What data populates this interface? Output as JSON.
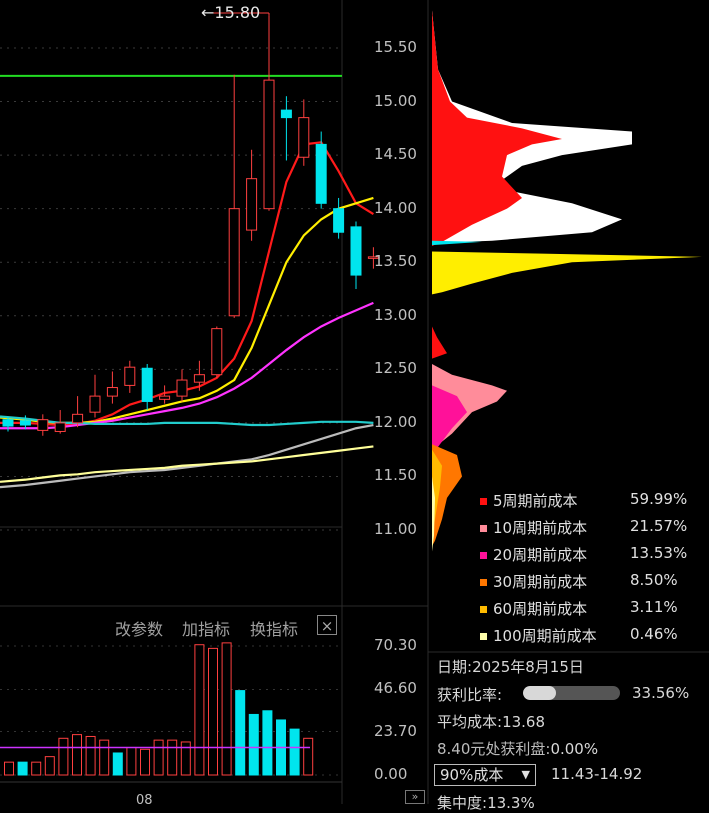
{
  "chart_data": [
    {
      "type": "candlestick",
      "price_axis": {
        "ticks": [
          "15.50",
          "15.00",
          "14.50",
          "14.00",
          "13.50",
          "13.00",
          "12.50",
          "12.00",
          "11.50",
          "11.00"
        ],
        "range": [
          10.5,
          15.95
        ]
      },
      "max_marker": {
        "label": "15.80",
        "value": 15.8
      },
      "resistance_line": {
        "value": 15.24,
        "color": "#22dd22"
      },
      "candles": [
        {
          "o": 12.03,
          "c": 11.97,
          "h": 12.06,
          "l": 11.92
        },
        {
          "o": 12.02,
          "c": 11.98,
          "h": 12.07,
          "l": 11.94
        },
        {
          "o": 11.93,
          "c": 12.03,
          "h": 12.08,
          "l": 11.88
        },
        {
          "o": 11.92,
          "c": 12.0,
          "h": 12.12,
          "l": 11.9
        },
        {
          "o": 12.0,
          "c": 12.08,
          "h": 12.25,
          "l": 11.96
        },
        {
          "o": 12.1,
          "c": 12.25,
          "h": 12.45,
          "l": 12.05
        },
        {
          "o": 12.25,
          "c": 12.33,
          "h": 12.48,
          "l": 12.18
        },
        {
          "o": 12.35,
          "c": 12.52,
          "h": 12.58,
          "l": 12.28
        },
        {
          "o": 12.51,
          "c": 12.2,
          "h": 12.55,
          "l": 12.12
        },
        {
          "o": 12.22,
          "c": 12.25,
          "h": 12.35,
          "l": 12.18
        },
        {
          "o": 12.25,
          "c": 12.4,
          "h": 12.5,
          "l": 12.2
        },
        {
          "o": 12.38,
          "c": 12.45,
          "h": 12.58,
          "l": 12.3
        },
        {
          "o": 12.45,
          "c": 12.88,
          "h": 12.9,
          "l": 12.42
        },
        {
          "o": 13.0,
          "c": 14.0,
          "h": 15.25,
          "l": 12.98
        },
        {
          "o": 13.8,
          "c": 14.28,
          "h": 14.55,
          "l": 13.7
        },
        {
          "o": 14.0,
          "c": 15.2,
          "h": 15.8,
          "l": 13.98
        },
        {
          "o": 14.92,
          "c": 14.85,
          "h": 15.05,
          "l": 14.45
        },
        {
          "o": 14.48,
          "c": 14.85,
          "h": 15.02,
          "l": 14.4
        },
        {
          "o": 14.6,
          "c": 14.05,
          "h": 14.72,
          "l": 14.0
        },
        {
          "o": 14.0,
          "c": 13.78,
          "h": 14.1,
          "l": 13.72
        },
        {
          "o": 13.83,
          "c": 13.38,
          "h": 13.88,
          "l": 13.25
        },
        {
          "o": 13.55,
          "c": 13.55,
          "h": 13.64,
          "l": 13.44
        }
      ],
      "moving_averages": [
        {
          "color": "#ff1a1a",
          "values": [
            12.0,
            12.0,
            11.99,
            11.98,
            11.99,
            12.02,
            12.08,
            12.17,
            12.22,
            12.28,
            12.3,
            12.34,
            12.42,
            12.6,
            12.95,
            13.6,
            14.25,
            14.6,
            14.62,
            14.35,
            14.05,
            13.95
          ]
        },
        {
          "color": "#ffee00",
          "values": [
            12.05,
            12.03,
            12.01,
            12.0,
            12.0,
            12.01,
            12.04,
            12.08,
            12.12,
            12.16,
            12.2,
            12.23,
            12.3,
            12.4,
            12.7,
            13.1,
            13.5,
            13.75,
            13.9,
            14.0,
            14.05,
            14.1
          ]
        },
        {
          "color": "#ff33ff",
          "values": [
            11.95,
            11.95,
            11.95,
            11.96,
            11.98,
            12.0,
            12.02,
            12.05,
            12.08,
            12.11,
            12.14,
            12.18,
            12.24,
            12.32,
            12.42,
            12.55,
            12.68,
            12.8,
            12.9,
            12.98,
            13.05,
            13.12
          ]
        },
        {
          "color": "#22cccc",
          "values": [
            12.06,
            12.04,
            12.02,
            12.0,
            12.0,
            11.99,
            11.99,
            11.99,
            11.99,
            12.0,
            12.0,
            12.0,
            12.0,
            11.99,
            11.98,
            11.98,
            11.99,
            12.0,
            12.01,
            12.01,
            12.01,
            12.0
          ]
        },
        {
          "color": "#bbbbbb",
          "values": [
            11.4,
            11.42,
            11.44,
            11.46,
            11.48,
            11.5,
            11.52,
            11.54,
            11.55,
            11.56,
            11.58,
            11.6,
            11.62,
            11.64,
            11.66,
            11.7,
            11.75,
            11.8,
            11.85,
            11.9,
            11.95,
            11.98
          ]
        },
        {
          "color": "#ffff99",
          "values": [
            11.45,
            11.47,
            11.49,
            11.51,
            11.52,
            11.54,
            11.55,
            11.56,
            11.57,
            11.58,
            11.6,
            11.61,
            11.62,
            11.63,
            11.64,
            11.66,
            11.68,
            11.7,
            11.72,
            11.74,
            11.76,
            11.78
          ]
        }
      ]
    },
    {
      "type": "bar",
      "volume_axis": {
        "ticks": [
          "70.30",
          "46.60",
          "23.70",
          "0.00"
        ],
        "range": [
          0,
          73
        ]
      },
      "values": [
        7,
        7,
        7,
        10,
        20,
        22,
        21,
        19,
        12,
        15,
        14,
        19,
        19,
        18,
        71,
        69,
        72,
        46,
        33,
        35,
        30,
        25,
        20
      ],
      "up": [
        true,
        false,
        true,
        true,
        true,
        true,
        true,
        true,
        false,
        true,
        true,
        true,
        true,
        true,
        true,
        true,
        true,
        false,
        false,
        false,
        false,
        false,
        true
      ],
      "avg_line": 15,
      "x_tick_label": "08"
    },
    {
      "type": "area",
      "title": "chip-distribution",
      "layers": [
        {
          "name": "5周期前成本",
          "color": "#ff1111",
          "pct": "59.99%"
        },
        {
          "name": "10周期前成本",
          "color": "#ff8c9a",
          "pct": "21.57%"
        },
        {
          "name": "20周期前成本",
          "color": "#ff1199",
          "pct": "13.53%"
        },
        {
          "name": "30周期前成本",
          "color": "#ff7700",
          "pct": "8.50%"
        },
        {
          "name": "60周期前成本",
          "color": "#ffbb00",
          "pct": "3.11%"
        },
        {
          "name": "100周期前成本",
          "color": "#ffffaa",
          "pct": "0.46%"
        }
      ]
    }
  ],
  "toolbar": {
    "param_label": "改参数",
    "add_indicator_label": "加指标",
    "switch_indicator_label": "换指标",
    "close_label": "×"
  },
  "info": {
    "date_label": "日期:",
    "date_value": "2025年8月15日",
    "profit_ratio_label": "获利比率:",
    "profit_ratio_value": "33.56%",
    "profit_ratio_fraction": 0.3356,
    "avg_cost_label": "平均成本:",
    "avg_cost_value": "13.68",
    "profit_at_label": "8.40元处获利盘:",
    "profit_at_value": "0.00%",
    "cost_select": "90%成本",
    "cost_range": "11.43-14.92",
    "concentration_label": "集中度:",
    "concentration_value": "13.3%"
  },
  "nav_icon": "double-chevron-right-icon"
}
